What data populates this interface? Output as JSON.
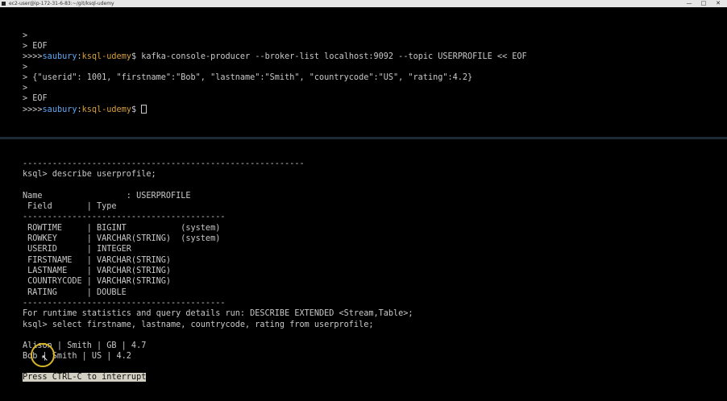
{
  "window": {
    "title": "ec2-user@ip-172-31-6-83:~/git/ksql-udemy",
    "minimize_glyph": "—",
    "maximize_glyph": "□",
    "close_glyph": "✕"
  },
  "top_pane": {
    "lines": [
      ">",
      "> EOF",
      "kafka-console-producer --broker-list localhost:9092 --topic USERPROFILE << EOF",
      ">",
      "> {\"userid\": 1001, \"firstname\":\"Bob\", \"lastname\":\"Smith\", \"countrycode\":\"US\", \"rating\":4.2}",
      ">",
      "> EOF"
    ],
    "prompt": {
      "prefix": ">>>>",
      "user": "saubury",
      "sep": ":",
      "dir": "ksql-udemy",
      "suffix": "$ "
    }
  },
  "bottom_pane": {
    "lines": [
      "---------------------------------------------------------",
      "ksql> describe userprofile;",
      "",
      "Name                 : USERPROFILE",
      " Field       | Type",
      "-----------------------------------------",
      " ROWTIME     | BIGINT           (system)",
      " ROWKEY      | VARCHAR(STRING)  (system)",
      " USERID      | INTEGER",
      " FIRSTNAME   | VARCHAR(STRING)",
      " LASTNAME    | VARCHAR(STRING)",
      " COUNTRYCODE | VARCHAR(STRING)",
      " RATING      | DOUBLE",
      "-----------------------------------------",
      "For runtime statistics and query details run: DESCRIBE EXTENDED <Stream,Table>;",
      "ksql> select firstname, lastname, countrycode, rating from userprofile;",
      "",
      "Alison | Smith | GB | 4.7",
      "Bob | Smith | US | 4.2",
      ""
    ],
    "interrupt_hint": "Press CTRL-C to interrupt"
  }
}
